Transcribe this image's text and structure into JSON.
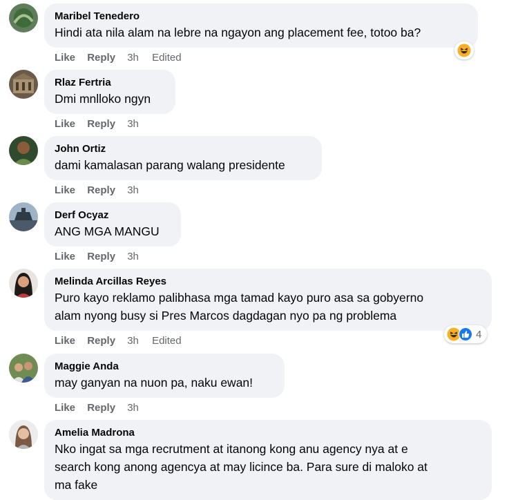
{
  "comments": [
    {
      "author": "Maribel Tenedero",
      "text": "Hindi ata nila alam na lebre na ngayon ang placement fee, totoo ba?",
      "actions": {
        "like": "Like",
        "reply": "Reply",
        "time": "3h",
        "edited": "Edited"
      },
      "reactions": {
        "icons": [
          "haha-icon"
        ]
      }
    },
    {
      "author": "Rlaz Fertria",
      "text": "Dmi mnlloko ngyn",
      "actions": {
        "like": "Like",
        "reply": "Reply",
        "time": "3h"
      }
    },
    {
      "author": "John Ortiz",
      "text": "dami kamalasan parang walang presidente",
      "actions": {
        "like": "Like",
        "reply": "Reply",
        "time": "3h"
      }
    },
    {
      "author": "Derf Ocyaz",
      "text": "ANG MGA MANGU",
      "actions": {
        "like": "Like",
        "reply": "Reply",
        "time": "3h"
      }
    },
    {
      "author": "Melinda Arcillas Reyes",
      "text_lines": [
        "Puro kayo reklamo palibhasa mga tamad kayo puro asa sa gobyerno",
        "alam nyong busy si Pres Marcos dagdagan nyo pa ng problema"
      ],
      "actions": {
        "like": "Like",
        "reply": "Reply",
        "time": "3h",
        "edited": "Edited"
      },
      "reactions": {
        "icons": [
          "haha-icon",
          "like-icon"
        ],
        "count": "4"
      }
    },
    {
      "author": "Maggie Anda",
      "text": "may ganyan na nuon pa, naku ewan!",
      "actions": {
        "like": "Like",
        "reply": "Reply",
        "time": "3h"
      }
    },
    {
      "author": "Amelia Madrona",
      "text_lines": [
        "Nko ingat sa mga recrutment at itanong kong anu agency nya at e",
        "search kong anong agencya at may licince ba. Para sure di maloko at",
        "ma fake"
      ]
    }
  ],
  "colors": {
    "bubble": "#f0f2f5",
    "meta_text": "#65676b",
    "like_blue": "#1877f2",
    "haha_yellow": "#f7b125"
  }
}
